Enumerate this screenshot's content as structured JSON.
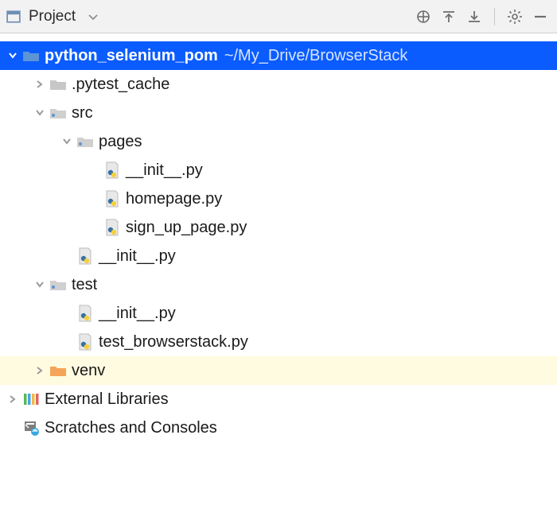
{
  "toolbar": {
    "title": "Project"
  },
  "tree": {
    "project": {
      "name": "python_selenium_pom",
      "path": "~/My_Drive/BrowserStack"
    },
    "pytest_cache": ".pytest_cache",
    "src": "src",
    "pages": "pages",
    "pages_init": "__init__.py",
    "homepage": "homepage.py",
    "sign_up": "sign_up_page.py",
    "src_init": "__init__.py",
    "test": "test",
    "test_init": "__init__.py",
    "test_bs": "test_browserstack.py",
    "venv": "venv",
    "extlib": "External Libraries",
    "scratches": "Scratches and Consoles"
  },
  "colors": {
    "selection": "#0a5cff",
    "highlight": "#fffbe0",
    "venv_folder": "#f5a45a",
    "folder_grey": "#c7c7c7",
    "folder_blue": "#5c94d6"
  }
}
